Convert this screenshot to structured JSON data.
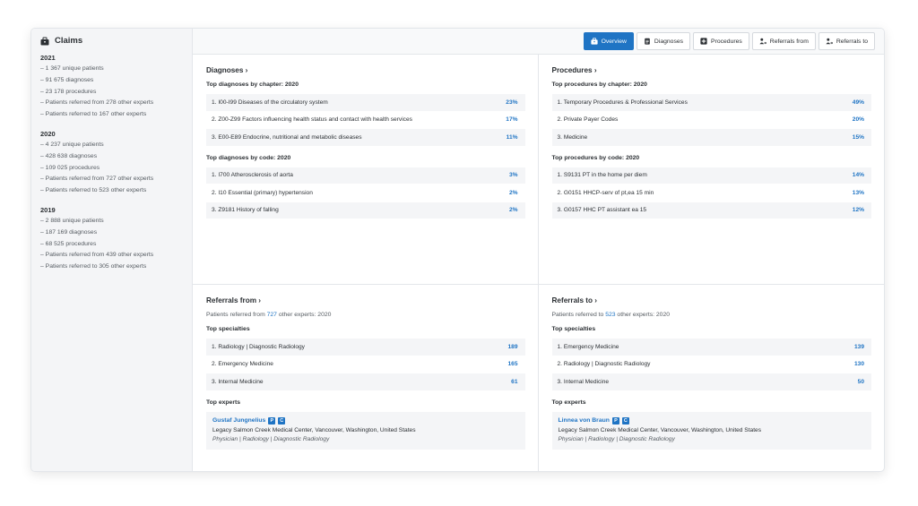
{
  "sidebar": {
    "title": "Claims",
    "years": [
      {
        "year": "2021",
        "lines": [
          "– 1 367 unique patients",
          "– 91 675 diagnoses",
          "– 23 178 procedures",
          "– Patients referred from 278 other experts",
          "– Patients referred to 167 other experts"
        ]
      },
      {
        "year": "2020",
        "lines": [
          "– 4 237 unique patients",
          "– 428 638 diagnoses",
          "– 109 025 procedures",
          "– Patients referred from 727 other experts",
          "– Patients referred to 523 other experts"
        ]
      },
      {
        "year": "2019",
        "lines": [
          "– 2 888 unique patients",
          "– 187 169 diagnoses",
          "– 68 525 procedures",
          "– Patients referred from 439 other experts",
          "– Patients referred to 305 other experts"
        ]
      }
    ]
  },
  "tabs": [
    {
      "label": "Overview",
      "icon": "briefcase-icon",
      "active": true
    },
    {
      "label": "Diagnoses",
      "icon": "clipboard-icon",
      "active": false
    },
    {
      "label": "Procedures",
      "icon": "plus-square-icon",
      "active": false
    },
    {
      "label": "Referrals from",
      "icon": "person-arrow-icon",
      "active": false
    },
    {
      "label": "Referrals to",
      "icon": "person-arrow-icon",
      "active": false
    }
  ],
  "diagnoses": {
    "title": "Diagnoses ›",
    "chapter_sub": "Top diagnoses by chapter: 2020",
    "chapter_rows": [
      {
        "label": "1. I00-I99 Diseases of the circulatory system",
        "value": "23%"
      },
      {
        "label": "2. Z00-Z99 Factors influencing health status and contact with health services",
        "value": "17%"
      },
      {
        "label": "3. E00-E89 Endocrine, nutritional and metabolic diseases",
        "value": "11%"
      }
    ],
    "code_sub": "Top diagnoses by code: 2020",
    "code_rows": [
      {
        "label": "1. I700 Atherosclerosis of aorta",
        "value": "3%"
      },
      {
        "label": "2. I10 Essential (primary) hypertension",
        "value": "2%"
      },
      {
        "label": "3. Z9181 History of falling",
        "value": "2%"
      }
    ]
  },
  "procedures": {
    "title": "Procedures ›",
    "chapter_sub": "Top procedures by chapter: 2020",
    "chapter_rows": [
      {
        "label": "1. Temporary Procedures & Professional Services",
        "value": "49%"
      },
      {
        "label": "2. Private Payer Codes",
        "value": "20%"
      },
      {
        "label": "3. Medicine",
        "value": "15%"
      }
    ],
    "code_sub": "Top procedures by code: 2020",
    "code_rows": [
      {
        "label": "1. S9131 PT in the home per diem",
        "value": "14%"
      },
      {
        "label": "2. G0151 HHCP-serv of pt,ea 15 min",
        "value": "13%"
      },
      {
        "label": "3. G0157 HHC PT assistant ea 15",
        "value": "12%"
      }
    ]
  },
  "referrals_from": {
    "title": "Referrals from ›",
    "note_prefix": "Patients referred from ",
    "note_num": "727",
    "note_suffix": " other experts: 2020",
    "spec_sub": "Top specialties",
    "rows": [
      {
        "label": "1. Radiology | Diagnostic Radiology",
        "value": "189"
      },
      {
        "label": "2. Emergency Medicine",
        "value": "165"
      },
      {
        "label": "3. Internal Medicine",
        "value": "61"
      }
    ],
    "experts_sub": "Top experts",
    "expert": {
      "name": "Gustaf Jungnelius",
      "badges": [
        "P",
        "C"
      ],
      "location": "Legacy Salmon Creek Medical Center, Vancouver, Washington, United States",
      "role": "Physician | Radiology | Diagnostic Radiology"
    }
  },
  "referrals_to": {
    "title": "Referrals to ›",
    "note_prefix": "Patients referred to ",
    "note_num": "523",
    "note_suffix": " other experts: 2020",
    "spec_sub": "Top specialties",
    "rows": [
      {
        "label": "1. Emergency Medicine",
        "value": "139"
      },
      {
        "label": "2. Radiology | Diagnostic Radiology",
        "value": "130"
      },
      {
        "label": "3. Internal Medicine",
        "value": "50"
      }
    ],
    "experts_sub": "Top experts",
    "expert": {
      "name": "Linnea von Braun",
      "badges": [
        "P",
        "C"
      ],
      "location": "Legacy Salmon Creek Medical Center, Vancouver, Washington, United States",
      "role": "Physician | Radiology | Diagnostic Radiology"
    }
  },
  "colors": {
    "accent": "#1f74c4",
    "sidebar_bg": "#f4f5f7",
    "row_bg": "#f4f5f7"
  }
}
